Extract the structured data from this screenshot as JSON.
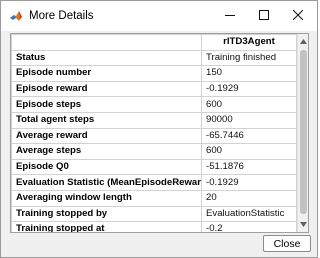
{
  "window": {
    "title": "More Details"
  },
  "table": {
    "column_header": "rlTD3Agent",
    "rows": [
      {
        "label": "Status",
        "value": "Training finished"
      },
      {
        "label": "Episode number",
        "value": "150"
      },
      {
        "label": "Episode reward",
        "value": "-0.1929"
      },
      {
        "label": "Episode steps",
        "value": "600"
      },
      {
        "label": "Total agent steps",
        "value": "90000"
      },
      {
        "label": "Average reward",
        "value": "-65.7446"
      },
      {
        "label": "Average steps",
        "value": "600"
      },
      {
        "label": "Episode Q0",
        "value": "-51.1876"
      },
      {
        "label": "Evaluation Statistic (MeanEpisodeReward)",
        "value": "-0.1929"
      },
      {
        "label": "Averaging window length",
        "value": "20"
      },
      {
        "label": "Training stopped by",
        "value": "EvaluationStatistic"
      },
      {
        "label": "Training stopped at",
        "value": "-0.2"
      }
    ]
  },
  "buttons": {
    "close_label": "Close"
  },
  "icons": {
    "app": "matlab-icon",
    "minimize": "minimize-icon",
    "maximize": "maximize-icon",
    "close": "close-icon"
  }
}
